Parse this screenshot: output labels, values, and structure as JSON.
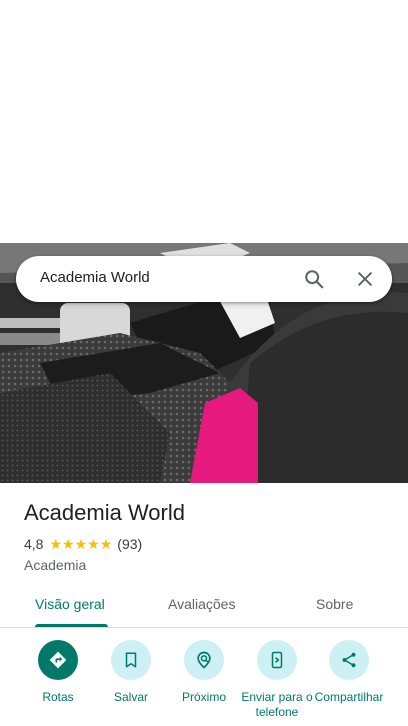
{
  "search": {
    "query": "Academia World"
  },
  "place": {
    "title": "Academia World",
    "rating": "4,8",
    "stars": 5,
    "reviews": "(93)",
    "category": "Academia"
  },
  "tabs": [
    {
      "label": "Visão geral",
      "active": true
    },
    {
      "label": "Avaliações",
      "active": false
    },
    {
      "label": "Sobre",
      "active": false
    }
  ],
  "actions": [
    {
      "label": "Rotas",
      "icon": "directions-icon"
    },
    {
      "label": "Salvar",
      "icon": "bookmark-icon"
    },
    {
      "label": "Próximo",
      "icon": "nearby-icon"
    },
    {
      "label": "Enviar para o telefone",
      "icon": "send-to-phone-icon"
    },
    {
      "label": "Compartilhar",
      "icon": "share-icon"
    }
  ],
  "colors": {
    "accent": "#00796b",
    "action_bg": "#ccf0f3",
    "star": "#fbbc04"
  }
}
